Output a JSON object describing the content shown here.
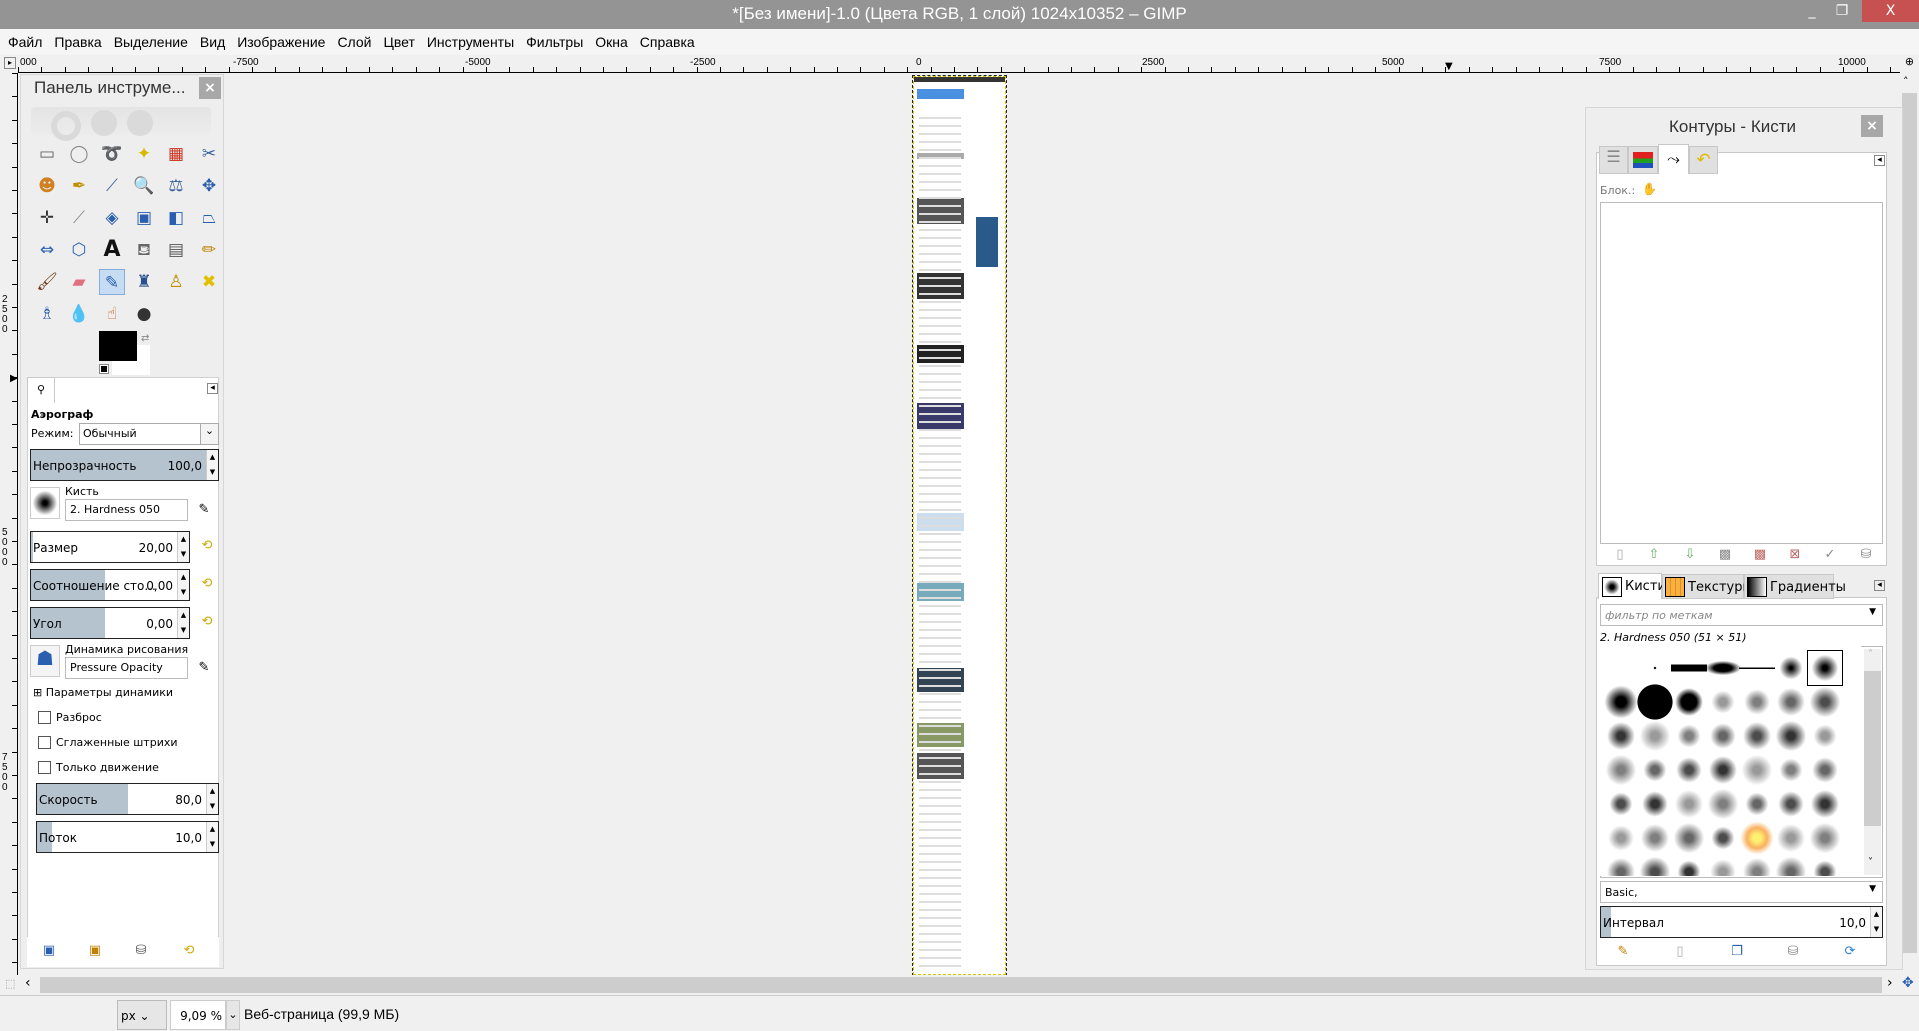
{
  "window": {
    "title": "*[Без имени]-1.0 (Цвета RGB, 1 слой) 1024x10352 – GIMP",
    "minimize": "_",
    "maximize": "❐",
    "close": "X"
  },
  "menu": [
    "Файл",
    "Правка",
    "Выделение",
    "Вид",
    "Изображение",
    "Слой",
    "Цвет",
    "Инструменты",
    "Фильтры",
    "Окна",
    "Справка"
  ],
  "ruler_top": [
    "000",
    "-7500",
    "-5000",
    "-2500",
    "0",
    "2500",
    "5000",
    "7500",
    "10000"
  ],
  "ruler_left": [
    "2500",
    "5000",
    "7500"
  ],
  "toolbox": {
    "title": "Панель инструме...",
    "close": "×",
    "tools": [
      {
        "name": "rect-select",
        "glyph": "▭",
        "color": "#666"
      },
      {
        "name": "ellipse-select",
        "glyph": "◯",
        "color": "#888"
      },
      {
        "name": "free-select",
        "glyph": "➰",
        "color": "#888"
      },
      {
        "name": "fuzzy-select",
        "glyph": "✦",
        "color": "#d9b800"
      },
      {
        "name": "select-by-color",
        "glyph": "▦",
        "color": "#d03020"
      },
      {
        "name": "scissors",
        "glyph": "✂",
        "color": "#3a5fa0"
      },
      {
        "name": "foreground-select",
        "glyph": "☻",
        "color": "#d08020"
      },
      {
        "name": "paths",
        "glyph": "✒",
        "color": "#c09000"
      },
      {
        "name": "color-picker",
        "glyph": "⟋",
        "color": "#3a5fa0"
      },
      {
        "name": "zoom",
        "glyph": "🔍",
        "color": "#5a7ab0"
      },
      {
        "name": "measure",
        "glyph": "⚖",
        "color": "#3a5fa0"
      },
      {
        "name": "move",
        "glyph": "✥",
        "color": "#2a5fb0"
      },
      {
        "name": "align",
        "glyph": "✛",
        "color": "#333"
      },
      {
        "name": "crop",
        "glyph": "⟋",
        "color": "#888"
      },
      {
        "name": "rotate",
        "glyph": "◈",
        "color": "#2a5fb0"
      },
      {
        "name": "scale",
        "glyph": "▣",
        "color": "#2a5fb0"
      },
      {
        "name": "shear",
        "glyph": "◧",
        "color": "#2a5fb0"
      },
      {
        "name": "perspective",
        "glyph": "⏢",
        "color": "#2a5fb0"
      },
      {
        "name": "flip",
        "glyph": "⇔",
        "color": "#2a5fb0"
      },
      {
        "name": "cage",
        "glyph": "⬡",
        "color": "#2a5fb0"
      },
      {
        "name": "text",
        "glyph": "A",
        "color": "#111"
      },
      {
        "name": "bucket-fill",
        "glyph": "⛾",
        "color": "#666"
      },
      {
        "name": "gradient",
        "glyph": "▤",
        "color": "#555"
      },
      {
        "name": "pencil",
        "glyph": "✏",
        "color": "#c08000"
      },
      {
        "name": "paintbrush",
        "glyph": "🖌",
        "color": "#704020"
      },
      {
        "name": "eraser",
        "glyph": "▰",
        "color": "#e07080"
      },
      {
        "name": "airbrush",
        "glyph": "✎",
        "color": "#2a5fb0"
      },
      {
        "name": "ink",
        "glyph": "♜",
        "color": "#2a4f90"
      },
      {
        "name": "clone",
        "glyph": "♙",
        "color": "#c09000"
      },
      {
        "name": "heal",
        "glyph": "✖",
        "color": "#e0c000"
      },
      {
        "name": "perspective-clone",
        "glyph": "♗",
        "color": "#2a5fb0"
      },
      {
        "name": "blur",
        "glyph": "💧",
        "color": "#4a8ad0"
      },
      {
        "name": "smudge",
        "glyph": "☝",
        "color": "#c06020"
      },
      {
        "name": "dodge-burn",
        "glyph": "●",
        "color": "#333"
      }
    ],
    "options": {
      "tab_icon": "tool-options-icon",
      "tool_name": "Аэрограф",
      "mode_label": "Режим:",
      "mode_value": "Обычный",
      "opacity": {
        "label": "Непрозрачность",
        "value": "100,0",
        "fraction": 1.0
      },
      "brush_label": "Кисть",
      "brush_value": "2. Hardness 050",
      "size": {
        "label": "Размер",
        "value": "20,00",
        "fraction": 0.01
      },
      "ratio": {
        "label": "Соотношение сто...",
        "value": "0,00",
        "fraction": 0.5
      },
      "angle": {
        "label": "Угол",
        "value": "0,00",
        "fraction": 0.5
      },
      "dynamics_label": "Динамика рисования",
      "dynamics_value": "Pressure Opacity",
      "dynamics_params": "Параметры динамики",
      "scatter": {
        "label": "Разброс",
        "checked": false
      },
      "smooth": {
        "label": "Сглаженные штрихи",
        "checked": false
      },
      "motion_only": {
        "label": "Только движение",
        "checked": false
      },
      "rate": {
        "label": "Скорость",
        "value": "80,0",
        "fraction": 0.5
      },
      "flow": {
        "label": "Поток",
        "value": "10,0",
        "fraction": 0.1
      }
    }
  },
  "dock": {
    "title": "Контуры - Кисти",
    "close": "×",
    "lock_label": "Блок.:",
    "brush_tabs": [
      "Кисти",
      "Текстуры",
      "Градиенты"
    ],
    "filter_placeholder": "фильтр по меткам",
    "selected_brush": "2. Hardness 050 (51 × 51)",
    "tag_value": "Basic,",
    "spacing": {
      "label": "Интервал",
      "value": "10,0",
      "fraction": 0.1
    }
  },
  "statusbar": {
    "unit": "px",
    "zoom": "9,09 %",
    "info": "Веб-страница (99,9 МБ)"
  },
  "colors": {
    "foreground": "#000000",
    "background": "#ffffff",
    "accent": "#c6dcf3",
    "close_red": "#c75050"
  }
}
